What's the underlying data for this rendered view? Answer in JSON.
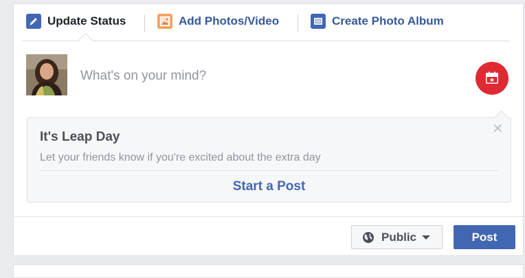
{
  "tabs": [
    {
      "label": "Update Status",
      "icon": "pencil-icon",
      "active": true
    },
    {
      "label": "Add Photos/Video",
      "icon": "photo-icon",
      "active": false
    },
    {
      "label": "Create Photo Album",
      "icon": "album-icon",
      "active": false
    }
  ],
  "composer": {
    "placeholder": "What's on your mind?",
    "sticker_icon": "sticker-icon"
  },
  "leap_card": {
    "title": "It's Leap Day",
    "description": "Let your friends know if you're excited about the extra day",
    "cta": "Start a Post",
    "close_symbol": "✕"
  },
  "footer": {
    "privacy_label": "Public",
    "post_label": "Post"
  },
  "colors": {
    "link": "#365899",
    "primary": "#4267b2",
    "sticker_red": "#e02a33",
    "page_bg": "#e9ebee"
  }
}
